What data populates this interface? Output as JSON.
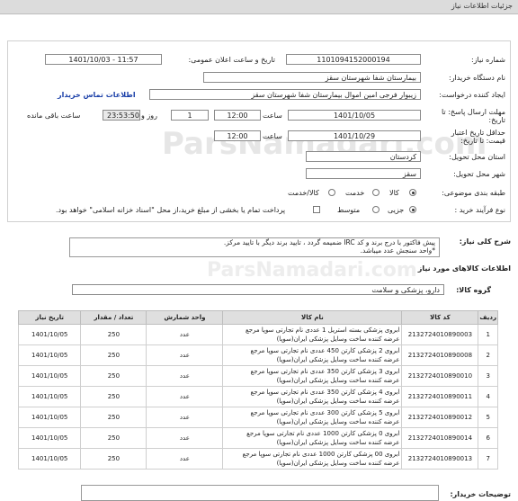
{
  "title": "جزئیات اطلاعات نیاز",
  "fields": {
    "need_number_label": "شماره نیاز:",
    "need_number": "1101094152000194",
    "announce_label": "تاریخ و ساعت اعلان عمومی:",
    "announce_value": "1401/10/03 - 11:57",
    "buyer_org_label": "نام دستگاه خریدار:",
    "buyer_org": "بیمارستان شفا شهرستان سقز",
    "creator_label": "ایجاد کننده درخواست:",
    "creator": "زیبوار فرجی امین اموال بیمارستان شفا شهرستان سقز",
    "contact_link": "اطلاعات تماس خریدار",
    "deadline_label": "مهلت ارسال پاسخ: تا تاریخ:",
    "deadline_date": "1401/10/05",
    "time_label": "ساعت",
    "deadline_time": "12:00",
    "day_label": "روز و",
    "days_value": "1",
    "remaining_time": "23:53:50",
    "remaining_label": "ساعت باقی مانده",
    "validity_label": "حداقل تاریخ اعتبار قیمت: تا تاریخ:",
    "validity_date": "1401/10/29",
    "validity_time": "12:00",
    "province_label": "استان محل تحویل:",
    "province": "کردستان",
    "city_label": "شهر محل تحویل:",
    "city": "سقز",
    "category_label": "طبقه بندی موضوعی:",
    "cat_goods": "کالا",
    "cat_service": "خدمت",
    "cat_goods_service": "کالا/خدمت",
    "process_label": "نوع فرآیند خرید :",
    "proc_small": "جزیی",
    "proc_medium": "متوسط",
    "payment_note": "پرداخت تمام یا بخشی از مبلغ خرید،از محل \"اسناد خزانه اسلامی\" خواهد بود."
  },
  "description": {
    "label": "شرح کلی نیاز:",
    "line1": "پیش فاکتور با درج برند و کد IRC ضمیمه گردد ، تایید برند دیگر با تایید مرکز.",
    "line2": "*واحد سنجش عدد میباشد."
  },
  "goods": {
    "section_title": "اطلاعات کالاهای مورد نیاز",
    "group_label": "گروه کالا:",
    "group_value": "دارو، پزشکی و سلامت",
    "headers": {
      "row": "ردیف",
      "code": "کد کالا",
      "name": "نام کالا",
      "unit": "واحد شمارش",
      "qty": "تعداد / مقدار",
      "date": "تاریخ نیاز"
    },
    "rows": [
      {
        "row": "1",
        "code": "2132724010890003",
        "name1": "ابروی پزشکی بسته استریل 1 عددی نام تجارتی سوپا مرجع",
        "name2": "عرضه کننده ساخت وسایل پزشکی ایران(سوپا)",
        "unit": "عدد",
        "qty": "250",
        "date": "1401/10/05"
      },
      {
        "row": "2",
        "code": "2132724010890008",
        "name1": "ابروی 2 پزشکی کارتن 450 عددی نام تجارتی سوپا مرجع",
        "name2": "عرضه کننده ساخت وسایل پزشکی ایران(سوپا)",
        "unit": "عدد",
        "qty": "250",
        "date": "1401/10/05"
      },
      {
        "row": "3",
        "code": "2132724010890010",
        "name1": "ابروی 3 پزشکی کارتن 350 عددی نام تجارتی سوپا مرجع",
        "name2": "عرضه کننده ساخت وسایل پزشکی ایران(سوپا)",
        "unit": "عدد",
        "qty": "250",
        "date": "1401/10/05"
      },
      {
        "row": "4",
        "code": "2132724010890011",
        "name1": "ابروی 4 پزشکی کارتن 350 عددی نام تجارتی سوپا مرجع",
        "name2": "عرضه کننده ساخت وسایل پزشکی ایران(سوپا)",
        "unit": "عدد",
        "qty": "250",
        "date": "1401/10/05"
      },
      {
        "row": "5",
        "code": "2132724010890012",
        "name1": "ابروی 5 پزشکی کارتن 300 عددی نام تجارتی سوپا مرجع",
        "name2": "عرضه کننده ساخت وسایل پزشکی ایران(سوپا)",
        "unit": "عدد",
        "qty": "250",
        "date": "1401/10/05"
      },
      {
        "row": "6",
        "code": "2132724010890014",
        "name1": "ابروی 0 پزشکی کارتن 1000 عددی نام تجارتی سوپا مرجع",
        "name2": "عرضه کننده ساخت وسایل پزشکی ایران(سوپا)",
        "unit": "عدد",
        "qty": "250",
        "date": "1401/10/05"
      },
      {
        "row": "7",
        "code": "2132724010890013",
        "name1": "ابروی 00 پزشکی کارتن 1000 عددی نام تجارتی سوپا مرجع",
        "name2": "عرضه کننده ساخت وسایل پزشکی ایران(سوپا)",
        "unit": "عدد",
        "qty": "250",
        "date": "1401/10/05"
      }
    ]
  },
  "buyer_notes_label": "توضیحات خریدار:",
  "watermark": "ParsNamadari.com"
}
